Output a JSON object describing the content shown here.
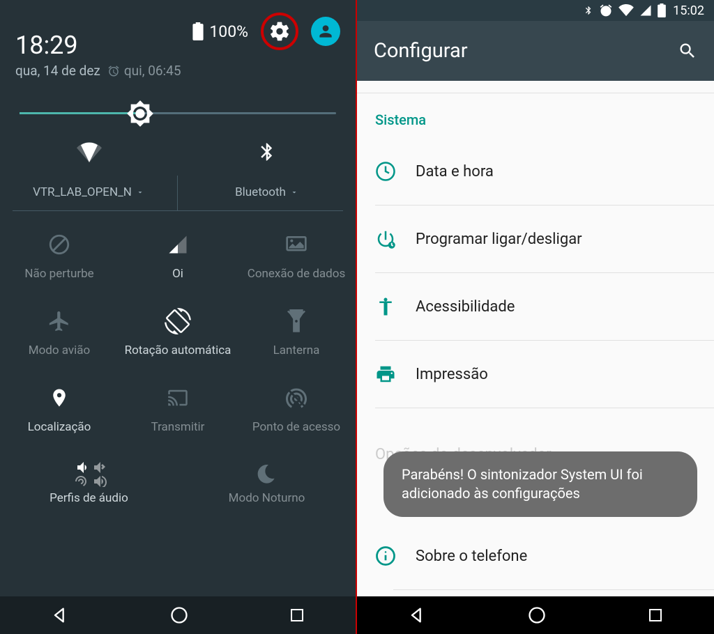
{
  "left": {
    "battery": "100%",
    "time": "18:29",
    "date": "qua, 14 de dez",
    "alarm": "qui, 06:45",
    "wifi": {
      "label": "VTR_LAB_OPEN_N"
    },
    "bluetooth": {
      "label": "Bluetooth"
    },
    "tiles": {
      "dnd": "Não perturbe",
      "signal": "Oi",
      "data": "Conexão de dados",
      "airplane": "Modo avião",
      "rotate": "Rotação automática",
      "flashlight": "Lanterna",
      "location": "Localização",
      "cast": "Transmitir",
      "hotspot": "Ponto de acesso",
      "audio": "Perfis de áudio",
      "night": "Modo Noturno"
    }
  },
  "right": {
    "status_time": "15:02",
    "title": "Configurar",
    "section": "Sistema",
    "items": {
      "datetime": "Data e hora",
      "schedule": "Programar ligar/desligar",
      "accessibility": "Acessibilidade",
      "printing": "Impressão",
      "developer": "Opções do desenvolvedor",
      "about": "Sobre o telefone"
    },
    "toast": "Parabéns! O sintonizador System UI foi adicionado às configurações"
  }
}
